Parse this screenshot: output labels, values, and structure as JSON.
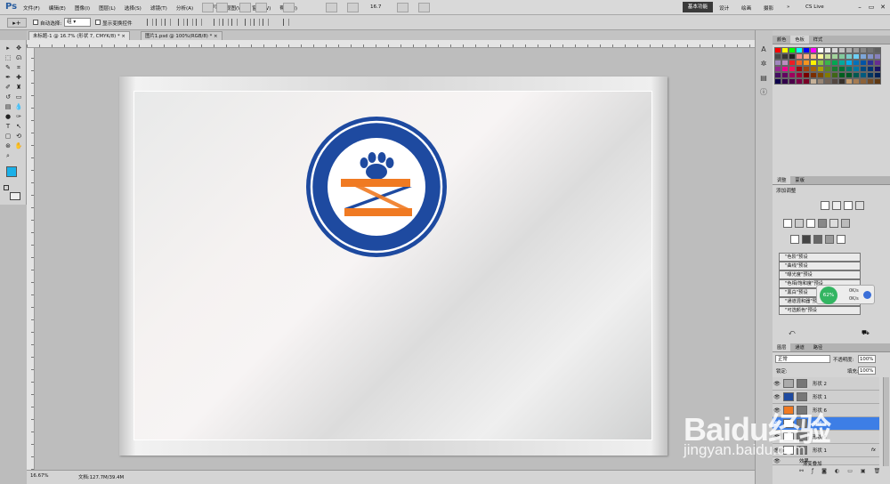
{
  "app": {
    "logo": "Ps",
    "menus": [
      "文件(F)",
      "编辑(E)",
      "图像(I)",
      "图层(L)",
      "选择(S)",
      "滤镜(T)",
      "分析(A)",
      "3D(D)",
      "视图(V)",
      "窗口(W)",
      "帮助(H)"
    ],
    "zoom": "16.7",
    "workspaces": [
      "基本功能",
      "设计",
      "绘画",
      "摄影"
    ],
    "workspace_more": "»",
    "cslive": "CS Live"
  },
  "options": {
    "auto_select_label": "自动选择:",
    "auto_select_value": "组",
    "show_transform_label": "显示变换控件"
  },
  "tabs": [
    {
      "label": "未标题-1 @ 16.7% (形状 7, CMYK/8) *"
    },
    {
      "label": "图片1.psd @ 100%(RGB/8) *"
    }
  ],
  "status": {
    "zoom": "16.67%",
    "doc": "文档:127.7M/39.4M"
  },
  "panels": {
    "swatch_tabs": [
      "颜色",
      "色板",
      "样式"
    ],
    "adjust_tabs": [
      "调整",
      "蒙版"
    ],
    "adjust_title": "添加调整",
    "presets": [
      "\"色阶\"预设",
      "\"曲线\"预设",
      "\"曝光度\"预设",
      "\"色相/饱和度\"预设",
      "\"黑白\"预设",
      "\"通道混和器\"预设",
      "\"可选颜色\"预设"
    ],
    "layers_tabs": [
      "图层",
      "通道",
      "路径"
    ],
    "blend_mode": "正常",
    "opacity_label": "不透明度:",
    "opacity_value": "100%",
    "lock_label": "锁定:",
    "fill_label": "填充:",
    "fill_value": "100%",
    "layers": [
      {
        "name": "形状 2",
        "color": "#aaaaaa",
        "selected": false
      },
      {
        "name": "形状 1",
        "color": "#1e4aa0",
        "selected": false
      },
      {
        "name": "形状 6",
        "color": "#f07a22",
        "selected": false
      },
      {
        "name": "形状 7",
        "color": "#ffffff",
        "selected": true
      },
      {
        "name": "形状 5",
        "color": "#ffffff",
        "selected": false
      },
      {
        "name": "形状 1",
        "color": "#ffffff",
        "selected": false
      }
    ],
    "effect_label": "效果",
    "effect_item": "渐变叠加",
    "fx": "fx"
  },
  "net_widget": {
    "percent": "62%",
    "up": "0K/s",
    "down": "0K/s"
  },
  "watermark": {
    "brand": "Baidu经验",
    "url": "jingyan.baidu.com"
  },
  "colors": {
    "logo_blue": "#1e4aa0",
    "logo_orange": "#f07a22",
    "accent": "#1ab0e8"
  }
}
